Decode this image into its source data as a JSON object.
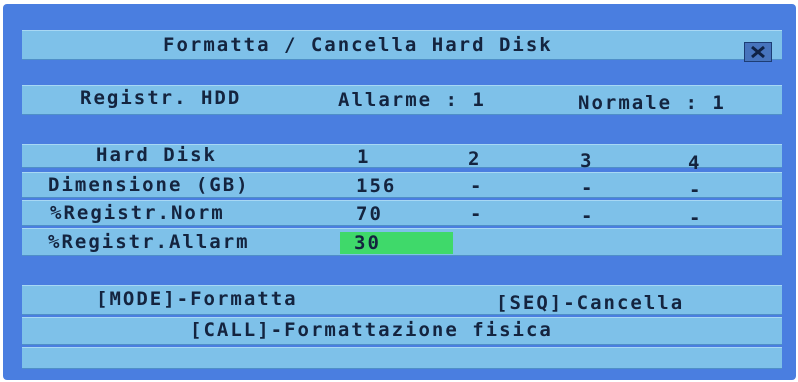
{
  "dialog": {
    "title": "Formatta / Cancella Hard Disk",
    "close_icon": "close-x-icon"
  },
  "registr_hdd": {
    "label": "Registr. HDD",
    "alarm_label": "Allarme : 1",
    "normal_label": "Normale : 1"
  },
  "hard_disk_table": {
    "header_label": "Hard Disk",
    "columns": [
      "1",
      "2",
      "3",
      "4"
    ],
    "rows": [
      {
        "label": "Dimensione (GB)",
        "values": [
          "156",
          "-",
          "-",
          "-"
        ]
      },
      {
        "label": "%Registr.Norm",
        "values": [
          "70",
          "-",
          "-",
          "-"
        ]
      },
      {
        "label": "%Registr.Allarm",
        "values": [
          "30"
        ]
      }
    ],
    "highlight_color": "#3fd96a"
  },
  "actions": {
    "format": "[MODE]-Formatta",
    "delete": "[SEQ]-Cancella",
    "physical_format": "[CALL]-Formattazione fisica"
  },
  "colors": {
    "screen_bg": "#4a7ee0",
    "bar_bg": "#7ec1e9",
    "text": "#14243f"
  }
}
